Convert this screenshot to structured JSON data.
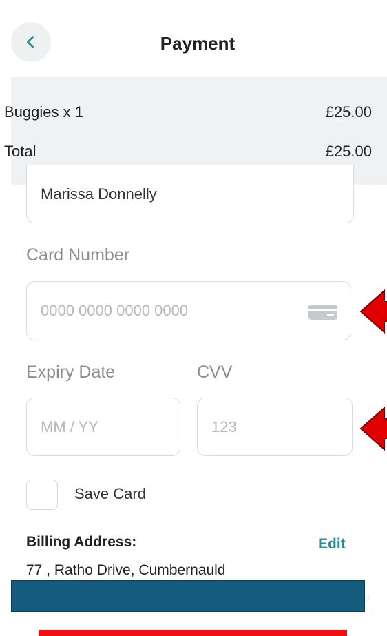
{
  "header": {
    "title": "Payment",
    "back_icon": "chevron-left-icon"
  },
  "summary": {
    "items": [
      {
        "label": "Buggies x 1",
        "amount": "£25.00"
      },
      {
        "label": "Total",
        "amount": "£25.00"
      }
    ]
  },
  "form": {
    "cardholder_value": "Marissa Donnelly",
    "card_number_label": "Card Number",
    "card_number_placeholder": "0000 0000 0000 0000",
    "card_icon": "credit-card-icon",
    "expiry_label": "Expiry Date",
    "expiry_placeholder": "MM / YY",
    "cvv_label": "CVV",
    "cvv_placeholder": "123",
    "save_card_label": "Save Card",
    "save_card_checked": false
  },
  "billing": {
    "label": "Billing Address:",
    "edit_label": "Edit",
    "address": "77 , Ratho Drive, Cumbernauld"
  },
  "colors": {
    "accent": "#2a8f95",
    "annotation_arrow": "#e00000",
    "redaction_bar": "#155b7d",
    "red_bar": "#ee1010"
  }
}
